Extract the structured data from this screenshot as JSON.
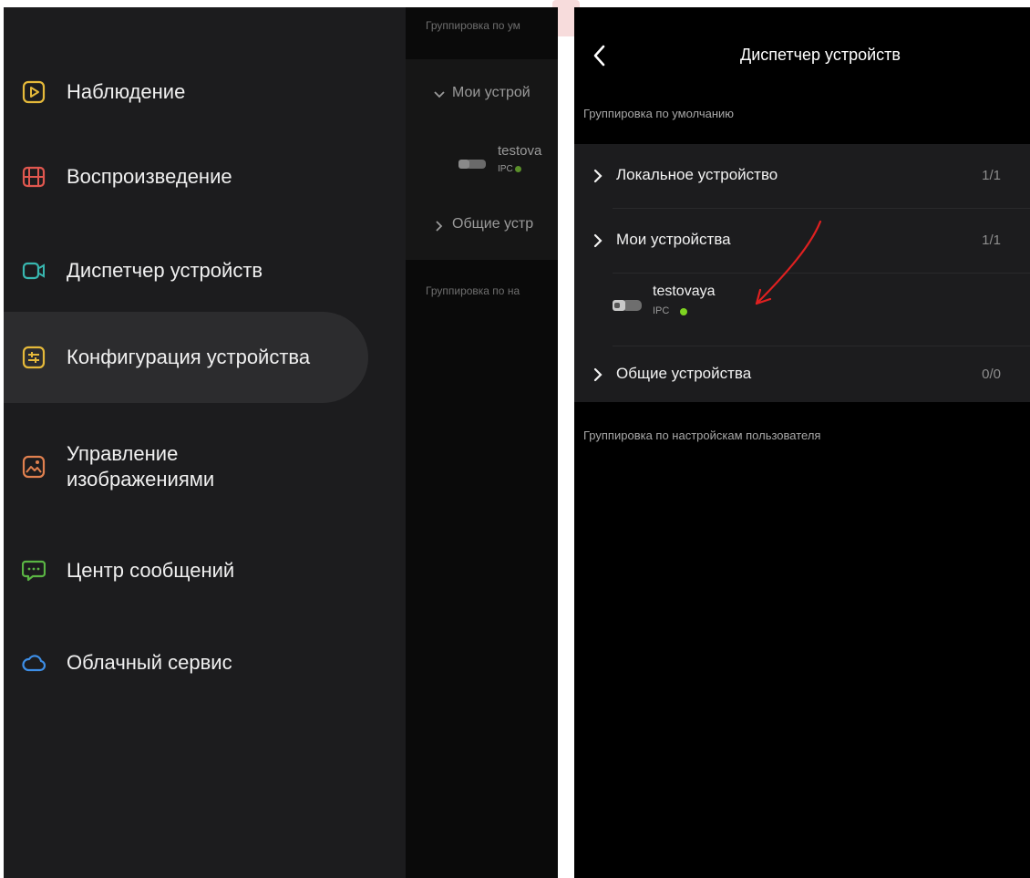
{
  "colors": {
    "drawer_bg": "#1c1c1e",
    "accent_online": "#7ed321",
    "annotation": "#e02020"
  },
  "drawer": {
    "items": [
      {
        "label": "Наблюдение",
        "icon": "play-box-icon",
        "color": "#e5b93a"
      },
      {
        "label": "Воспроизведение",
        "icon": "film-icon",
        "color": "#e0574f"
      },
      {
        "label": "Диспетчер устройств",
        "icon": "video-camera-icon",
        "color": "#38b7b0"
      },
      {
        "label": "Конфигурация устройства",
        "icon": "sliders-icon",
        "color": "#e5b93a",
        "active": true
      },
      {
        "label": "Управление\nизображениями",
        "icon": "image-icon",
        "color": "#e0804f"
      },
      {
        "label": "Центр сообщений",
        "icon": "chat-icon",
        "color": "#5ab544"
      },
      {
        "label": "Облачный сервис",
        "icon": "cloud-icon",
        "color": "#3d8ee6"
      }
    ]
  },
  "behind": {
    "default_group": "Группировка по ум",
    "my_devices": "Мои устрой",
    "device_name": "testova",
    "device_type": "IPC",
    "shared": "Общие устр",
    "user_group": "Группировка по на"
  },
  "right": {
    "title": "Диспетчер устройств",
    "default_group": "Группировка по умолчанию",
    "rows": [
      {
        "label": "Локальное устройство",
        "count": "1/1"
      },
      {
        "label": "Мои устройства",
        "count": "1/1"
      },
      {
        "label": "Общие устройства",
        "count": "0/0"
      }
    ],
    "device": {
      "name": "testovaya",
      "type": "IPC"
    },
    "user_group": "Группировка по настройскам пользователя"
  }
}
